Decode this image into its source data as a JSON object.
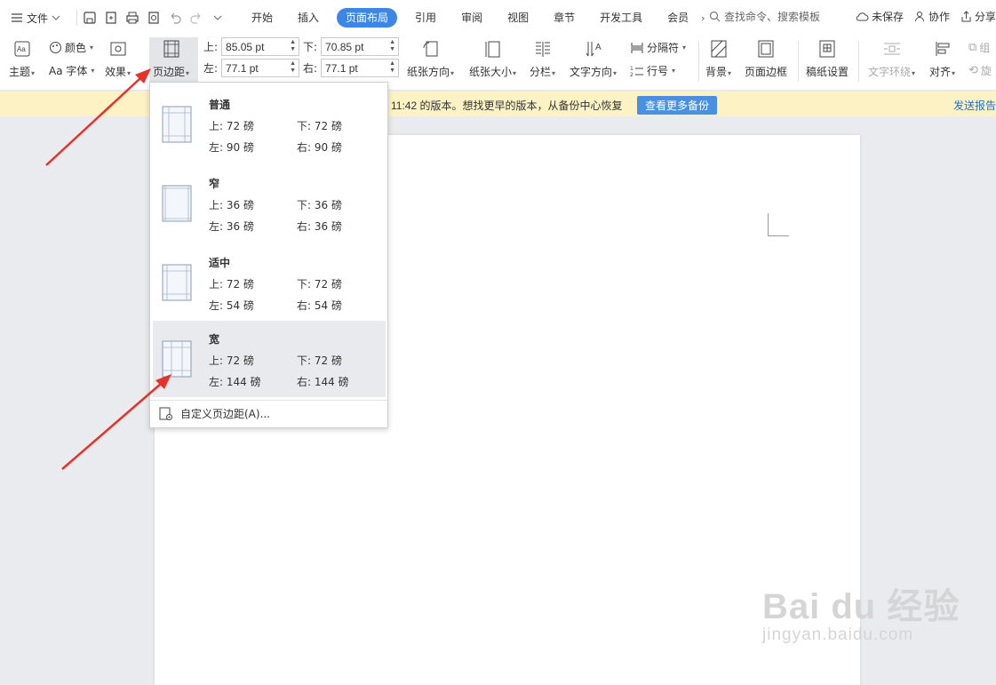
{
  "menu": {
    "file": "文件",
    "tabs": [
      "开始",
      "插入",
      "页面布局",
      "引用",
      "审阅",
      "视图",
      "章节",
      "开发工具",
      "会员"
    ],
    "active_tab": "页面布局",
    "search_placeholder": "查找命令、搜索模板",
    "unsaved": "未保存",
    "collab": "协作",
    "share": "分享"
  },
  "ribbon": {
    "theme": "主题",
    "color": "颜色",
    "font": "Aa 字体",
    "effect": "效果",
    "margins": "页边距",
    "top_label": "上:",
    "top_value": "85.05 pt",
    "bottom_label": "下:",
    "bottom_value": "70.85 pt",
    "left_label": "左:",
    "left_value": "77.1 pt",
    "right_label": "右:",
    "right_value": "77.1 pt",
    "orientation": "纸张方向",
    "size": "纸张大小",
    "columns": "分栏",
    "text_direction": "文字方向",
    "separator": "分隔符",
    "line_numbers": "行号",
    "background": "背景",
    "page_border": "页面边框",
    "manuscript": "稿纸设置",
    "text_wrap": "文字环绕",
    "align": "对齐",
    "group": "组",
    "rotate": "旋"
  },
  "notice": {
    "message": "11:42 的版本。想找更早的版本，从备份中心恢复",
    "button": "查看更多备份",
    "report": "发送报告"
  },
  "dropdown": {
    "presets": [
      {
        "name": "普通",
        "top": "上: 72 磅",
        "bottom": "下: 72 磅",
        "left": "左: 90 磅",
        "right": "右: 90 磅"
      },
      {
        "name": "窄",
        "top": "上: 36 磅",
        "bottom": "下: 36 磅",
        "left": "左: 36 磅",
        "right": "右: 36 磅"
      },
      {
        "name": "适中",
        "top": "上: 72 磅",
        "bottom": "下: 72 磅",
        "left": "左: 54 磅",
        "right": "右: 54 磅"
      },
      {
        "name": "宽",
        "top": "上: 72 磅",
        "bottom": "下: 72 磅",
        "left": "左: 144 磅",
        "right": "右: 144 磅"
      }
    ],
    "custom": "自定义页边距(A)..."
  },
  "watermark": {
    "big": "Bai du 经验",
    "small": "jingyan.baidu.com"
  },
  "colors": {
    "accent": "#3d86e6",
    "notice_bg": "#fdf2c4",
    "arrow": "#e8312a"
  }
}
